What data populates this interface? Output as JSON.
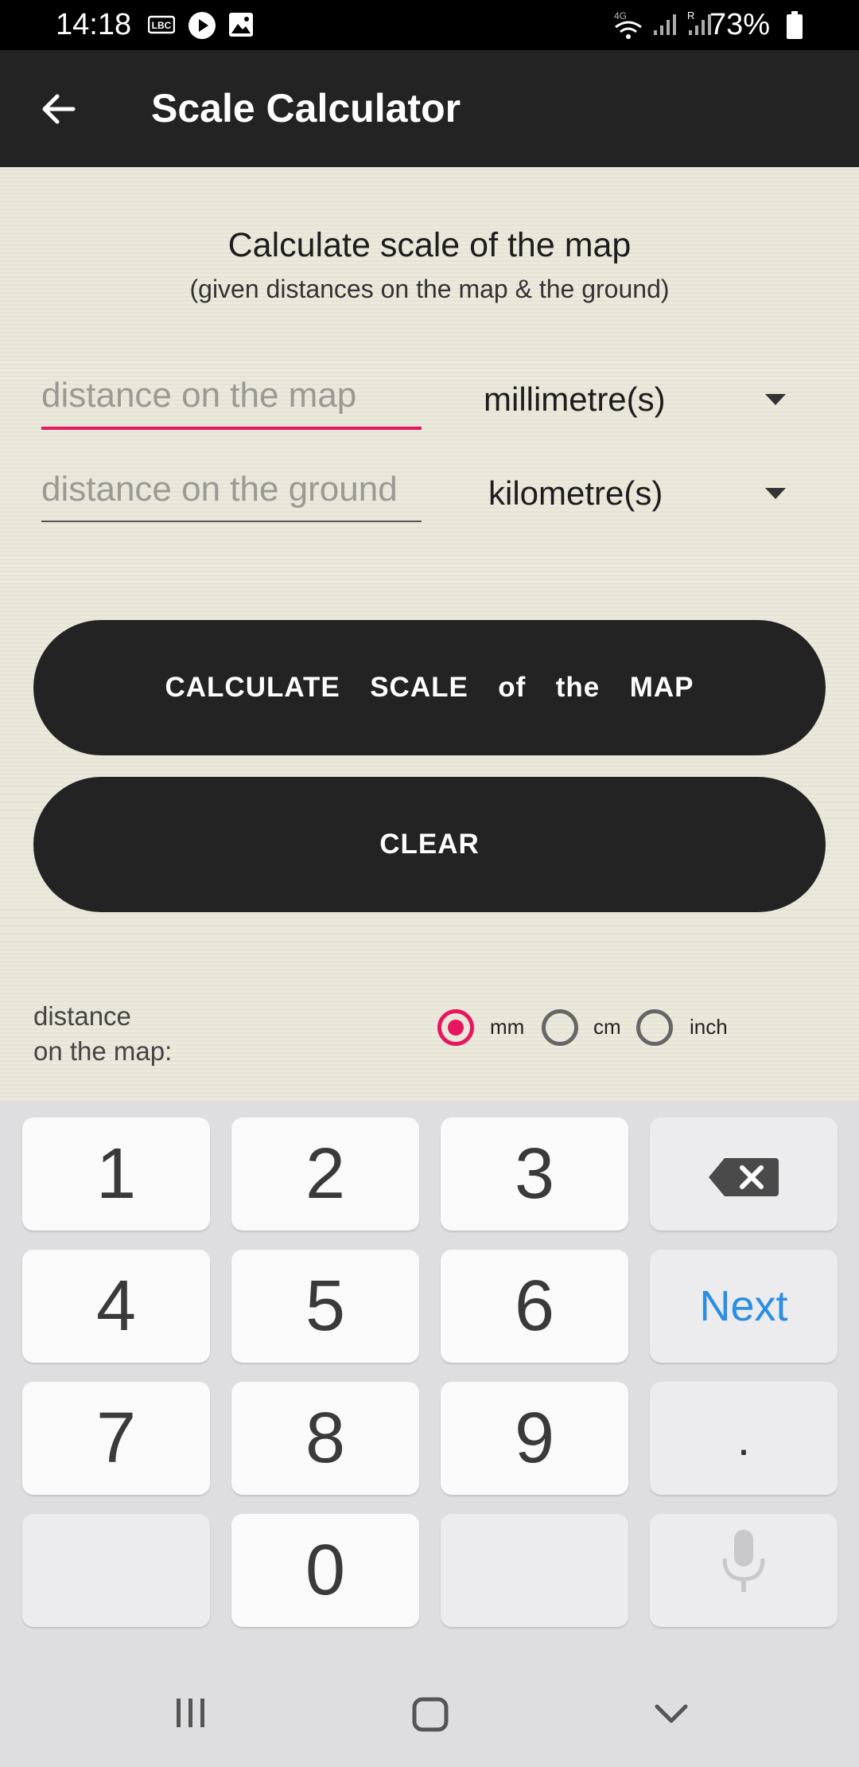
{
  "status_bar": {
    "time": "14:18",
    "battery": "73%",
    "icons": [
      "lbc-icon",
      "play-icon",
      "image-icon",
      "wifi-4g-icon",
      "signal-icon",
      "signal-roaming-icon",
      "battery-icon"
    ],
    "lbc_text": "LBC"
  },
  "app_bar": {
    "title": "Scale Calculator"
  },
  "main": {
    "heading": "Calculate scale of the map",
    "subheading": "(given distances on the map & the ground)",
    "map_distance": {
      "placeholder": "distance on the map",
      "value": "",
      "unit": "millimetre(s)"
    },
    "ground_distance": {
      "placeholder": "distance on the ground",
      "value": "",
      "unit": "kilometre(s)"
    },
    "calculate_button": "CALCULATE  SCALE  of  the  MAP",
    "clear_button": "CLEAR",
    "unit_selector": {
      "label_line1": "distance",
      "label_line2": "on the map:",
      "options": [
        "mm",
        "cm",
        "inch"
      ],
      "selected": "mm"
    }
  },
  "keyboard": {
    "keys": [
      "1",
      "2",
      "3",
      "4",
      "5",
      "6",
      "7",
      "8",
      "9",
      ".",
      "0"
    ],
    "next_label": "Next"
  },
  "colors": {
    "accent": "#e8155f",
    "toolbar": "#232323",
    "background": "#e9e8da",
    "next_key": "#2b8ee3"
  }
}
